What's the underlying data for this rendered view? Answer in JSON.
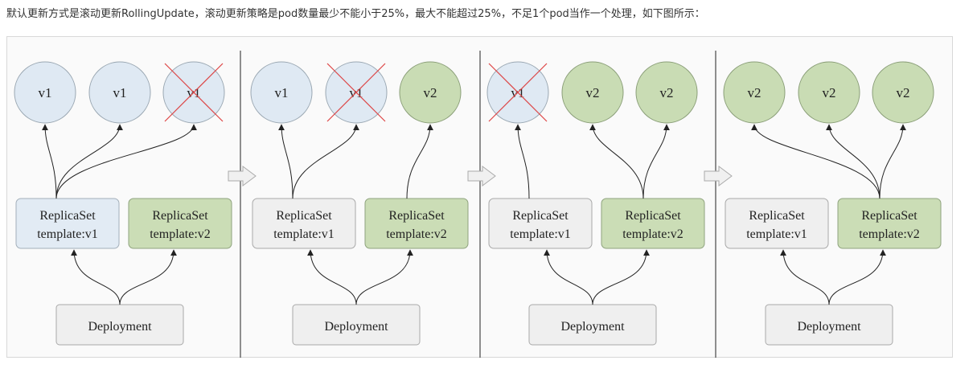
{
  "caption": "默认更新方式是滚动更新RollingUpdate，滚动更新策略是pod数量最少不能小于25%，最大不能超过25%，不足1个pod当作一个处理，如下图所示：",
  "rs_label": "ReplicaSet",
  "deployment_label": "Deployment",
  "colors": {
    "v1": "#dfe9f3",
    "v2": "#c9dcb4",
    "idle": "#efefef",
    "cross": "#dd4444"
  },
  "stages": [
    {
      "pods": [
        {
          "label": "v1",
          "version": "v1",
          "terminating": false
        },
        {
          "label": "v1",
          "version": "v1",
          "terminating": false
        },
        {
          "label": "v1",
          "version": "v1",
          "terminating": true
        }
      ],
      "rs": [
        {
          "template": "template:v1",
          "active": true
        },
        {
          "template": "template:v2",
          "active": true
        }
      ]
    },
    {
      "pods": [
        {
          "label": "v1",
          "version": "v1",
          "terminating": false
        },
        {
          "label": "v1",
          "version": "v1",
          "terminating": true
        },
        {
          "label": "v2",
          "version": "v2",
          "terminating": false
        }
      ],
      "rs": [
        {
          "template": "template:v1",
          "active": false
        },
        {
          "template": "template:v2",
          "active": true
        }
      ]
    },
    {
      "pods": [
        {
          "label": "v1",
          "version": "v1",
          "terminating": true
        },
        {
          "label": "v2",
          "version": "v2",
          "terminating": false
        },
        {
          "label": "v2",
          "version": "v2",
          "terminating": false
        }
      ],
      "rs": [
        {
          "template": "template:v1",
          "active": false
        },
        {
          "template": "template:v2",
          "active": true
        }
      ]
    },
    {
      "pods": [
        {
          "label": "v2",
          "version": "v2",
          "terminating": false
        },
        {
          "label": "v2",
          "version": "v2",
          "terminating": false
        },
        {
          "label": "v2",
          "version": "v2",
          "terminating": false
        }
      ],
      "rs": [
        {
          "template": "template:v1",
          "active": false
        },
        {
          "template": "template:v2",
          "active": true
        }
      ]
    }
  ]
}
